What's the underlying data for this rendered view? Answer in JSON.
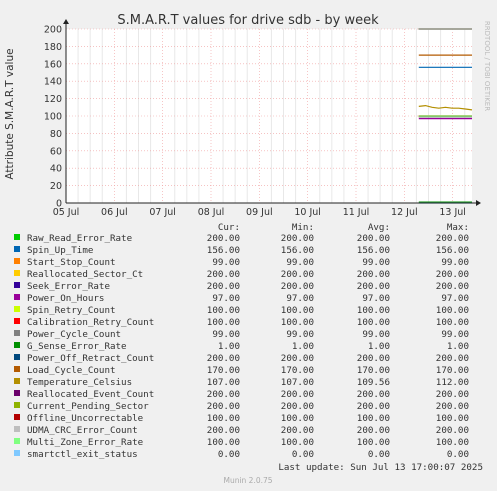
{
  "chart_data": {
    "type": "line",
    "title": "S.M.A.R.T values for drive sdb - by week",
    "ylabel": "Attribute S.M.A.R.T value",
    "xlabel": "",
    "watermark": "RRDTOOL / TOBI OETIKER",
    "ylim": [
      0,
      200
    ],
    "yticks": [
      0,
      20,
      40,
      60,
      80,
      100,
      120,
      140,
      160,
      180,
      200
    ],
    "xlim": [
      0,
      8.4
    ],
    "x_categories": [
      "05 Jul",
      "06 Jul",
      "07 Jul",
      "08 Jul",
      "09 Jul",
      "10 Jul",
      "11 Jul",
      "12 Jul",
      "13 Jul"
    ],
    "data_start": 7.3,
    "grid": true,
    "legend_headers": {
      "cur": "Cur:",
      "min": "Min:",
      "avg": "Avg:",
      "max": "Max:"
    },
    "series": [
      {
        "name": "Raw_Read_Error_Rate",
        "color": "#00cc00",
        "cur": "200.00",
        "min": "200.00",
        "avg": "200.00",
        "max": "200.00",
        "values": [
          200,
          200
        ]
      },
      {
        "name": "Spin_Up_Time",
        "color": "#0066b3",
        "cur": "156.00",
        "min": "156.00",
        "avg": "156.00",
        "max": "156.00",
        "values": [
          156,
          156
        ]
      },
      {
        "name": "Start_Stop_Count",
        "color": "#ff8000",
        "cur": "99.00",
        "min": "99.00",
        "avg": "99.00",
        "max": "99.00",
        "values": [
          99,
          99
        ]
      },
      {
        "name": "Reallocated_Sector_Ct",
        "color": "#ffcc00",
        "cur": "200.00",
        "min": "200.00",
        "avg": "200.00",
        "max": "200.00",
        "values": [
          200,
          200
        ]
      },
      {
        "name": "Seek_Error_Rate",
        "color": "#330099",
        "cur": "200.00",
        "min": "200.00",
        "avg": "200.00",
        "max": "200.00",
        "values": [
          200,
          200
        ]
      },
      {
        "name": "Power_On_Hours",
        "color": "#990099",
        "cur": "97.00",
        "min": "97.00",
        "avg": "97.00",
        "max": "97.00",
        "values": [
          97,
          97
        ]
      },
      {
        "name": "Spin_Retry_Count",
        "color": "#ccff00",
        "cur": "100.00",
        "min": "100.00",
        "avg": "100.00",
        "max": "100.00",
        "values": [
          100,
          100
        ]
      },
      {
        "name": "Calibration_Retry_Count",
        "color": "#ff0000",
        "cur": "100.00",
        "min": "100.00",
        "avg": "100.00",
        "max": "100.00",
        "values": [
          100,
          100
        ]
      },
      {
        "name": "Power_Cycle_Count",
        "color": "#808080",
        "cur": "99.00",
        "min": "99.00",
        "avg": "99.00",
        "max": "99.00",
        "values": [
          99,
          99
        ]
      },
      {
        "name": "G_Sense_Error_Rate",
        "color": "#008f00",
        "cur": "1.00",
        "min": "1.00",
        "avg": "1.00",
        "max": "1.00",
        "values": [
          1,
          1
        ]
      },
      {
        "name": "Power_Off_Retract_Count",
        "color": "#00487d",
        "cur": "200.00",
        "min": "200.00",
        "avg": "200.00",
        "max": "200.00",
        "values": [
          200,
          200
        ]
      },
      {
        "name": "Load_Cycle_Count",
        "color": "#b35a00",
        "cur": "170.00",
        "min": "170.00",
        "avg": "170.00",
        "max": "170.00",
        "values": [
          170,
          170
        ]
      },
      {
        "name": "Temperature_Celsius",
        "color": "#b38f00",
        "cur": "107.00",
        "min": "107.00",
        "avg": "109.56",
        "max": "112.00",
        "values": [
          111,
          112,
          110,
          109,
          110,
          109,
          109,
          108,
          107
        ]
      },
      {
        "name": "Reallocated_Event_Count",
        "color": "#6b006b",
        "cur": "200.00",
        "min": "200.00",
        "avg": "200.00",
        "max": "200.00",
        "values": [
          200,
          200
        ]
      },
      {
        "name": "Current_Pending_Sector",
        "color": "#8fb300",
        "cur": "200.00",
        "min": "200.00",
        "avg": "200.00",
        "max": "200.00",
        "values": [
          200,
          200
        ]
      },
      {
        "name": "Offline_Uncorrectable",
        "color": "#b30000",
        "cur": "100.00",
        "min": "100.00",
        "avg": "100.00",
        "max": "100.00",
        "values": [
          100,
          100
        ]
      },
      {
        "name": "UDMA_CRC_Error_Count",
        "color": "#bebebe",
        "cur": "200.00",
        "min": "200.00",
        "avg": "200.00",
        "max": "200.00",
        "values": [
          200,
          200
        ]
      },
      {
        "name": "Multi_Zone_Error_Rate",
        "color": "#80ff80",
        "cur": "100.00",
        "min": "100.00",
        "avg": "100.00",
        "max": "100.00",
        "values": [
          100,
          100
        ]
      },
      {
        "name": "smartctl_exit_status",
        "color": "#80c9ff",
        "cur": "0.00",
        "min": "0.00",
        "avg": "0.00",
        "max": "0.00",
        "values": [
          0,
          0
        ]
      }
    ],
    "last_update": "Last update: Sun Jul 13 17:00:07 2025",
    "footer": "Munin 2.0.75"
  }
}
